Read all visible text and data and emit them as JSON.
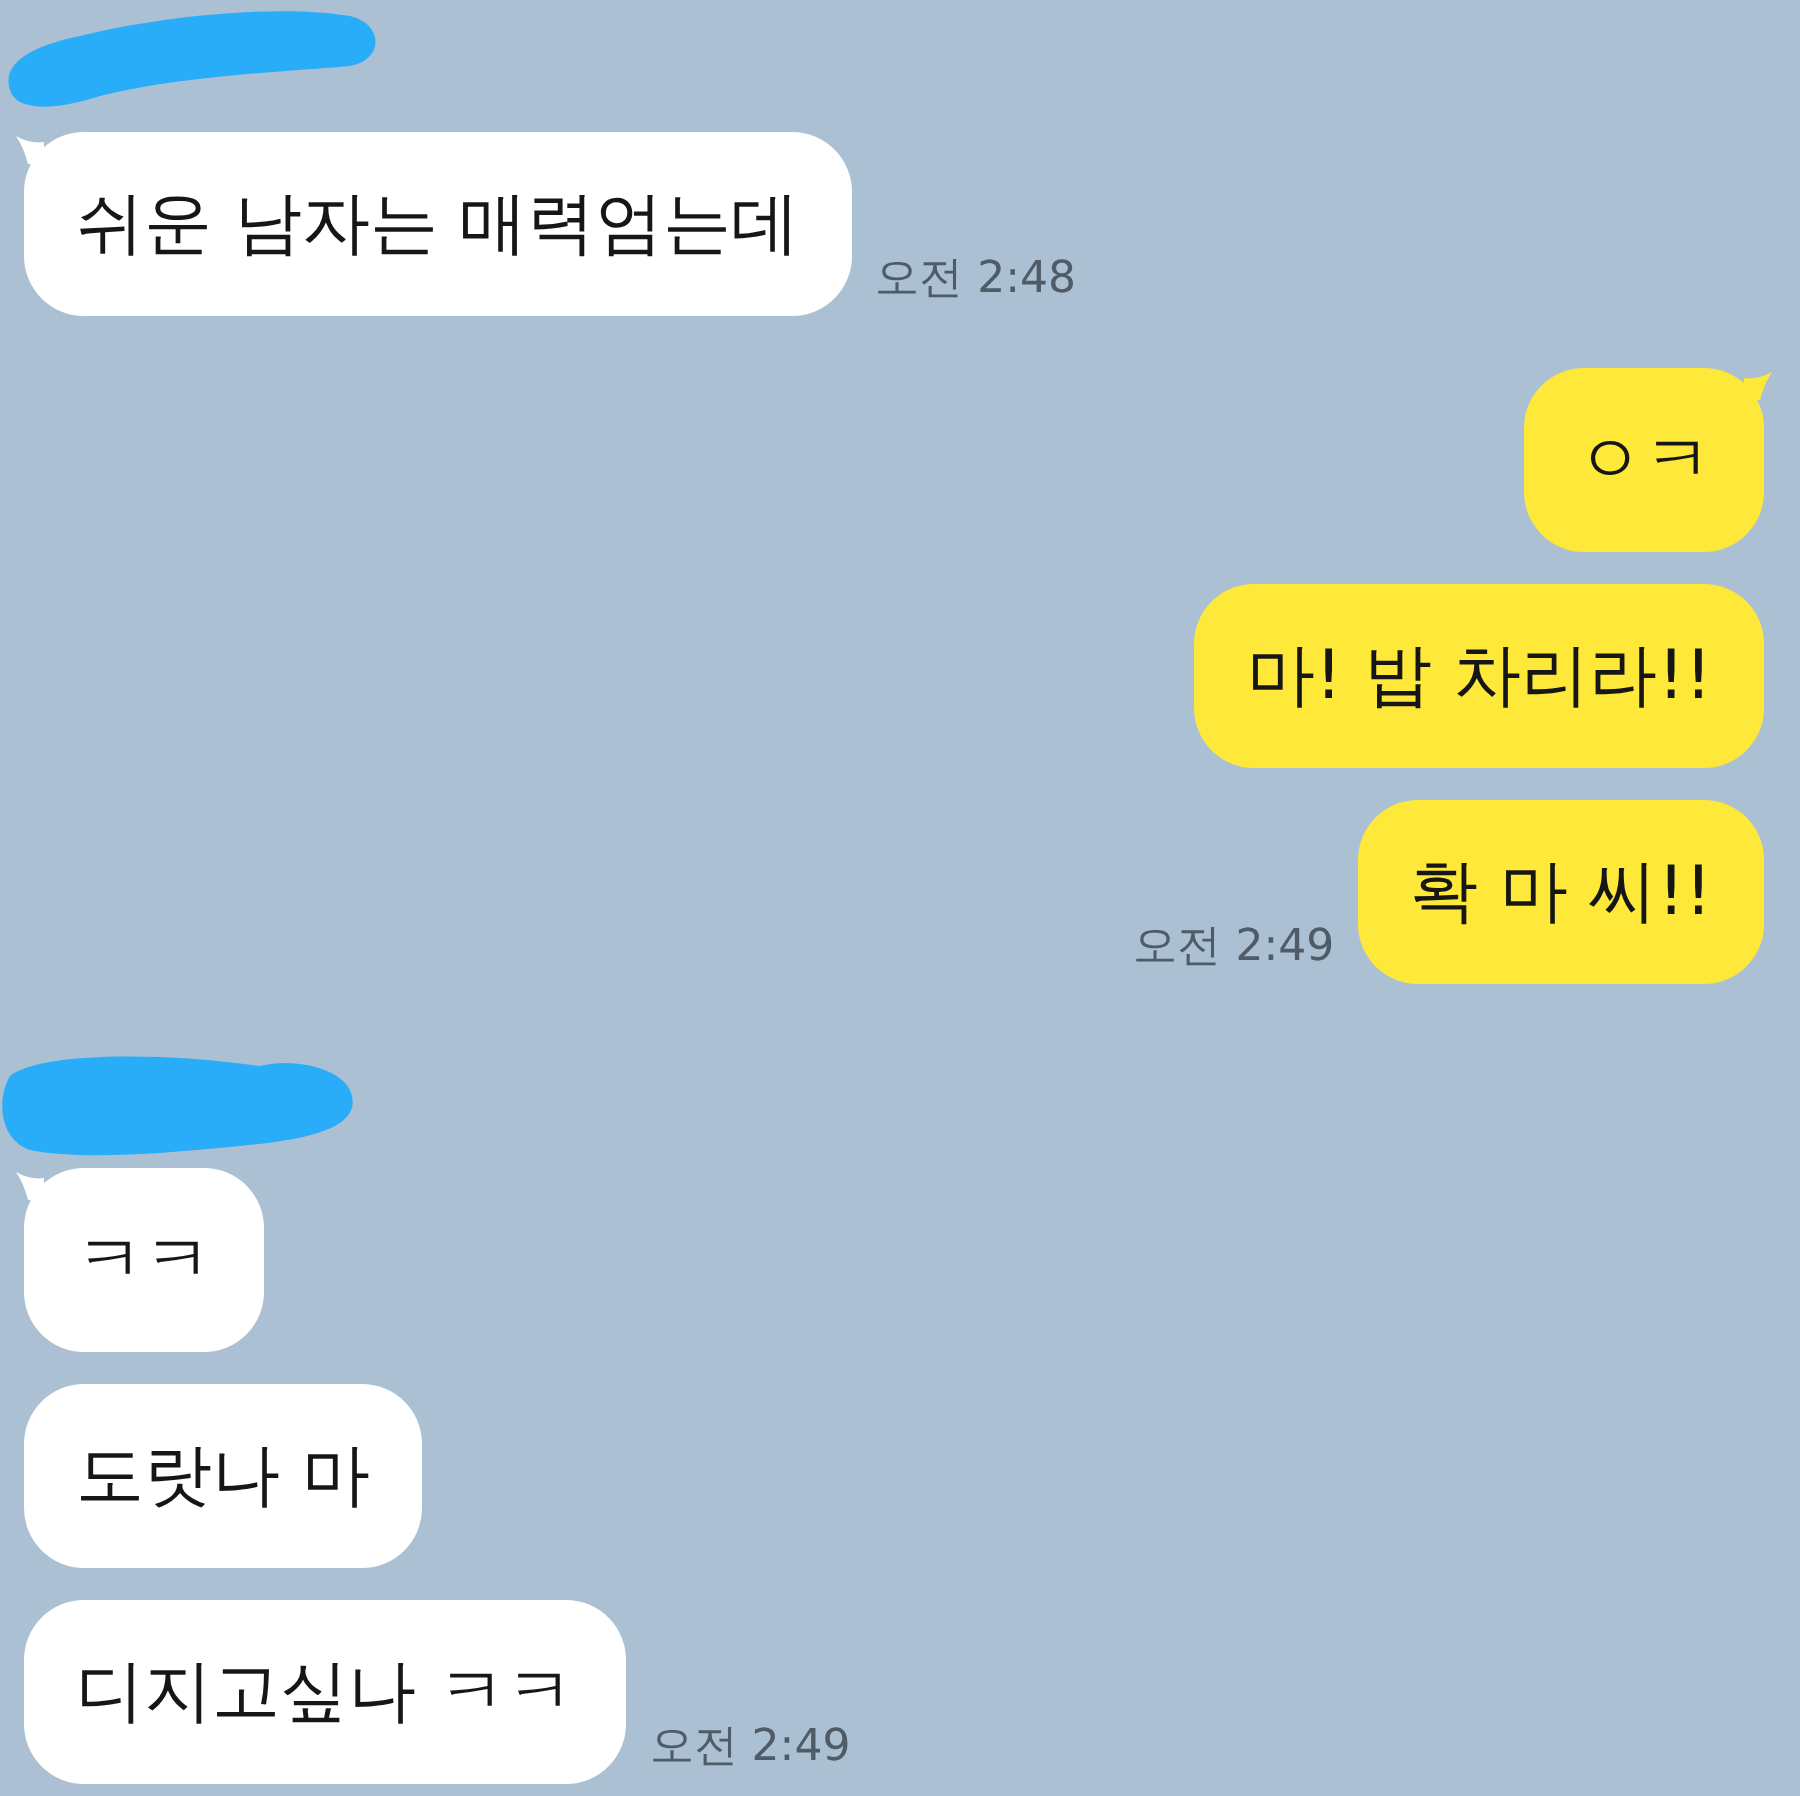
{
  "chat": {
    "groups": [
      {
        "kind": "incoming",
        "sender_name_redacted": true,
        "messages": [
          {
            "text": "쉬운 남자는 매력엄는데"
          }
        ],
        "time": "오전 2:48"
      },
      {
        "kind": "outgoing",
        "messages": [
          {
            "text": "ㅇㅋ"
          },
          {
            "text": "마! 밥 차리라!!"
          },
          {
            "text": "확 마 씨!!"
          }
        ],
        "time": "오전 2:49"
      },
      {
        "kind": "incoming",
        "sender_name_redacted": true,
        "messages": [
          {
            "text": "ㅋㅋ"
          },
          {
            "text": "도랏나 마"
          },
          {
            "text": "디지고싶나 ㅋㅋ"
          }
        ],
        "time": "오전 2:49"
      }
    ]
  }
}
